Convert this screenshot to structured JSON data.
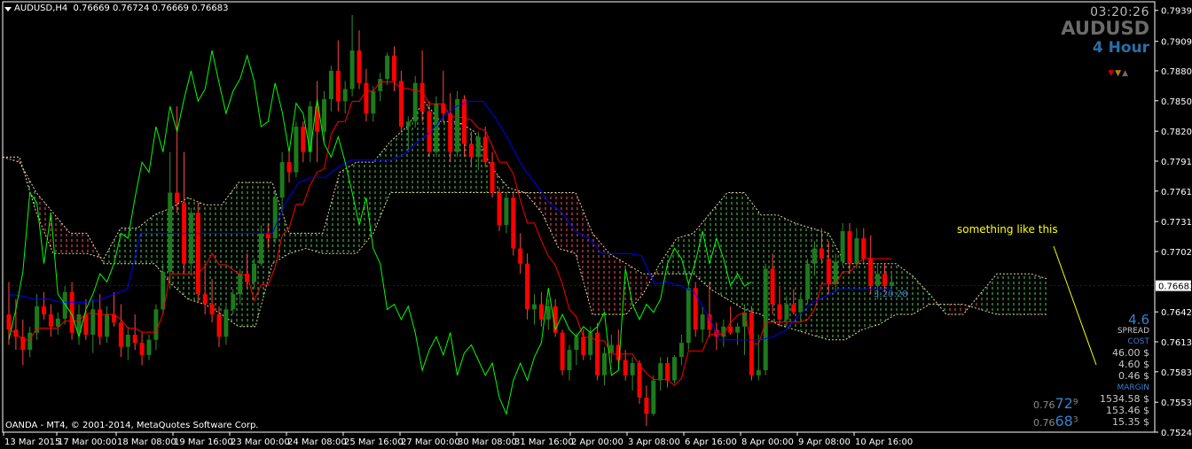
{
  "header": {
    "symbol_timeframe": "AUDUSD,H4",
    "ohlc": "0.76669 0.76724 0.76669 0.76683"
  },
  "overlay": {
    "clock": "03:20:26",
    "symbol": "AUDUSD",
    "timeframe": "4 Hour",
    "note": "something like this",
    "credit": "OANDA - MT4, © 2001-2014, MetaQuotes Software Corp.",
    "countdown": "3:20:28",
    "spread_value": "4.6",
    "spread_label": "SPREAD",
    "cost_label": "COST",
    "cost_values": [
      "46.00 $",
      "4.60 $",
      "0.46 $"
    ],
    "margin_label": "MARGIN",
    "margin_values": [
      "1534.58 $",
      "153.46 $",
      "15.35 $"
    ],
    "bid_prefix": "0.76",
    "bid_big": "72",
    "bid_sup": "9",
    "ask_prefix": "0.76",
    "ask_big": "68",
    "ask_sup": "3",
    "marker_colors": [
      "#cc0000",
      "#b8860b",
      "#6b6b6b"
    ]
  },
  "colors": {
    "background": "#000000",
    "bull": "#1c7a1c",
    "bear": "#ff0000",
    "tenkan": "#ff0000",
    "kijun": "#0000ff",
    "chikou": "#00ff00",
    "cloud_bear": "#ff5555",
    "cloud_bull": "#55cc55",
    "cloud_edge": "#e8d8a0",
    "grid_text": "#ffffff",
    "current_price_box": "#ffffff"
  },
  "chart_data": {
    "type": "candlestick",
    "symbol": "AUDUSD",
    "timeframe": "H4",
    "ylim": [
      0.7524,
      0.7948
    ],
    "y_ticks": [
      "0.79395",
      "0.79090",
      "0.78800",
      "0.78505",
      "0.78205",
      "0.77910",
      "0.77615",
      "0.77315",
      "0.77020",
      "0.76425",
      "0.76130",
      "0.75835",
      "0.75535",
      "0.75240"
    ],
    "current_price": "0.76683",
    "x_ticks": [
      "13 Mar 2015",
      "17 Mar 00:00",
      "18 Mar 08:00",
      "19 Mar 16:00",
      "23 Mar 00:00",
      "24 Mar 08:00",
      "25 Mar 16:00",
      "27 Mar 00:00",
      "30 Mar 08:00",
      "31 Mar 16:00",
      "2 Apr 00:00",
      "3 Apr 08:00",
      "6 Apr 16:00",
      "8 Apr 00:00",
      "9 Apr 08:00",
      "10 Apr 16:00"
    ],
    "candles": [
      [
        0.764,
        0.7672,
        0.761,
        0.7625
      ],
      [
        0.7625,
        0.7655,
        0.7605,
        0.7618
      ],
      [
        0.7618,
        0.7635,
        0.759,
        0.7605
      ],
      [
        0.7605,
        0.7628,
        0.7598,
        0.7622
      ],
      [
        0.7622,
        0.766,
        0.7615,
        0.7648
      ],
      [
        0.7648,
        0.7662,
        0.7635,
        0.764
      ],
      [
        0.764,
        0.765,
        0.7618,
        0.7628
      ],
      [
        0.7628,
        0.7642,
        0.762,
        0.7636
      ],
      [
        0.7636,
        0.7668,
        0.763,
        0.7662
      ],
      [
        0.7662,
        0.7672,
        0.7615,
        0.7622
      ],
      [
        0.7622,
        0.765,
        0.761,
        0.764
      ],
      [
        0.764,
        0.7655,
        0.7615,
        0.762
      ],
      [
        0.762,
        0.7655,
        0.7602,
        0.7645
      ],
      [
        0.7645,
        0.766,
        0.761,
        0.7618
      ],
      [
        0.7618,
        0.7648,
        0.7612,
        0.764
      ],
      [
        0.764,
        0.7662,
        0.7628,
        0.7632
      ],
      [
        0.7632,
        0.765,
        0.7598,
        0.7608
      ],
      [
        0.7608,
        0.7628,
        0.7595,
        0.762
      ],
      [
        0.762,
        0.764,
        0.7605,
        0.7612
      ],
      [
        0.7612,
        0.7622,
        0.759,
        0.76
      ],
      [
        0.76,
        0.762,
        0.7595,
        0.7615
      ],
      [
        0.7615,
        0.765,
        0.7605,
        0.7645
      ],
      [
        0.7645,
        0.769,
        0.764,
        0.7682
      ],
      [
        0.7682,
        0.78,
        0.7665,
        0.776
      ],
      [
        0.776,
        0.7845,
        0.774,
        0.775
      ],
      [
        0.775,
        0.78,
        0.768,
        0.769
      ],
      [
        0.769,
        0.7745,
        0.7678,
        0.774
      ],
      [
        0.774,
        0.775,
        0.7652,
        0.766
      ],
      [
        0.766,
        0.769,
        0.764,
        0.765
      ],
      [
        0.765,
        0.7675,
        0.7632,
        0.764
      ],
      [
        0.764,
        0.7648,
        0.7608,
        0.7618
      ],
      [
        0.7618,
        0.765,
        0.761,
        0.7645
      ],
      [
        0.7645,
        0.7665,
        0.764,
        0.766
      ],
      [
        0.766,
        0.7685,
        0.765,
        0.768
      ],
      [
        0.768,
        0.77,
        0.7665,
        0.7672
      ],
      [
        0.7672,
        0.7695,
        0.7665,
        0.769
      ],
      [
        0.769,
        0.7728,
        0.7688,
        0.772
      ],
      [
        0.772,
        0.773,
        0.7705,
        0.7715
      ],
      [
        0.7715,
        0.776,
        0.771,
        0.7755
      ],
      [
        0.7755,
        0.78,
        0.774,
        0.779
      ],
      [
        0.779,
        0.78,
        0.777,
        0.778
      ],
      [
        0.778,
        0.783,
        0.7775,
        0.7825
      ],
      [
        0.7825,
        0.783,
        0.779,
        0.78
      ],
      [
        0.78,
        0.785,
        0.779,
        0.7845
      ],
      [
        0.7845,
        0.787,
        0.779,
        0.782
      ],
      [
        0.782,
        0.786,
        0.781,
        0.7852
      ],
      [
        0.7852,
        0.7885,
        0.784,
        0.788
      ],
      [
        0.788,
        0.791,
        0.784,
        0.785
      ],
      [
        0.785,
        0.787,
        0.7838,
        0.7862
      ],
      [
        0.7862,
        0.7935,
        0.7855,
        0.79
      ],
      [
        0.79,
        0.792,
        0.7862,
        0.7868
      ],
      [
        0.7868,
        0.7882,
        0.783,
        0.7838
      ],
      [
        0.7838,
        0.7865,
        0.783,
        0.786
      ],
      [
        0.786,
        0.7878,
        0.785,
        0.7872
      ],
      [
        0.7872,
        0.7898,
        0.7866,
        0.7895
      ],
      [
        0.7895,
        0.7904,
        0.786,
        0.787
      ],
      [
        0.787,
        0.788,
        0.782,
        0.7825
      ],
      [
        0.7825,
        0.7835,
        0.78,
        0.783
      ],
      [
        0.783,
        0.7875,
        0.7824,
        0.7868
      ],
      [
        0.7868,
        0.79,
        0.783,
        0.784
      ],
      [
        0.784,
        0.785,
        0.7795,
        0.78
      ],
      [
        0.78,
        0.7855,
        0.7795,
        0.7848
      ],
      [
        0.7848,
        0.788,
        0.783,
        0.7838
      ],
      [
        0.7838,
        0.7858,
        0.779,
        0.78
      ],
      [
        0.78,
        0.786,
        0.7795,
        0.7852
      ],
      [
        0.7852,
        0.7856,
        0.7795,
        0.7808
      ],
      [
        0.7808,
        0.782,
        0.7785,
        0.7795
      ],
      [
        0.7795,
        0.782,
        0.7782,
        0.7815
      ],
      [
        0.7815,
        0.7825,
        0.7785,
        0.779
      ],
      [
        0.779,
        0.78,
        0.7755,
        0.776
      ],
      [
        0.776,
        0.7765,
        0.7722,
        0.7728
      ],
      [
        0.7728,
        0.776,
        0.772,
        0.7755
      ],
      [
        0.7755,
        0.776,
        0.7698,
        0.7705
      ],
      [
        0.7705,
        0.772,
        0.768,
        0.769
      ],
      [
        0.769,
        0.77,
        0.7635,
        0.7645
      ],
      [
        0.7645,
        0.766,
        0.763,
        0.765
      ],
      [
        0.765,
        0.7662,
        0.7628,
        0.7635
      ],
      [
        0.7635,
        0.7655,
        0.7625,
        0.7648
      ],
      [
        0.7648,
        0.7655,
        0.7618,
        0.7622
      ],
      [
        0.7622,
        0.7625,
        0.758,
        0.7585
      ],
      [
        0.7585,
        0.761,
        0.7575,
        0.7605
      ],
      [
        0.7605,
        0.7622,
        0.759,
        0.7618
      ],
      [
        0.7618,
        0.7625,
        0.7595,
        0.76
      ],
      [
        0.76,
        0.7628,
        0.7595,
        0.7622
      ],
      [
        0.7622,
        0.7632,
        0.7575,
        0.758
      ],
      [
        0.758,
        0.7608,
        0.757,
        0.7602
      ],
      [
        0.7602,
        0.762,
        0.7592,
        0.761
      ],
      [
        0.761,
        0.7625,
        0.759,
        0.7595
      ],
      [
        0.7595,
        0.7605,
        0.7575,
        0.758
      ],
      [
        0.758,
        0.7598,
        0.7565,
        0.7592
      ],
      [
        0.7592,
        0.7595,
        0.7552,
        0.7558
      ],
      [
        0.7558,
        0.757,
        0.753,
        0.7542
      ],
      [
        0.7542,
        0.758,
        0.754,
        0.7575
      ],
      [
        0.7575,
        0.7598,
        0.7565,
        0.7592
      ],
      [
        0.7592,
        0.7598,
        0.7568,
        0.7575
      ],
      [
        0.7575,
        0.76,
        0.7572,
        0.7598
      ],
      [
        0.7598,
        0.762,
        0.759,
        0.7612
      ],
      [
        0.7612,
        0.7672,
        0.7605,
        0.7666
      ],
      [
        0.7666,
        0.7672,
        0.7618,
        0.7625
      ],
      [
        0.7625,
        0.7648,
        0.7612,
        0.764
      ],
      [
        0.764,
        0.7672,
        0.7618,
        0.7625
      ],
      [
        0.7625,
        0.7632,
        0.7605,
        0.7618
      ],
      [
        0.7618,
        0.7635,
        0.7608,
        0.7628
      ],
      [
        0.7628,
        0.7648,
        0.762,
        0.7622
      ],
      [
        0.7622,
        0.7632,
        0.761,
        0.7628
      ],
      [
        0.7628,
        0.765,
        0.76,
        0.7642
      ],
      [
        0.7642,
        0.7648,
        0.7575,
        0.758
      ],
      [
        0.758,
        0.762,
        0.7575,
        0.7585
      ],
      [
        0.7585,
        0.769,
        0.758,
        0.7685
      ],
      [
        0.7685,
        0.77,
        0.764,
        0.765
      ],
      [
        0.765,
        0.7668,
        0.7628,
        0.7635
      ],
      [
        0.7635,
        0.7658,
        0.7628,
        0.765
      ],
      [
        0.765,
        0.7665,
        0.764,
        0.7642
      ],
      [
        0.7642,
        0.766,
        0.7635,
        0.7655
      ],
      [
        0.7655,
        0.7695,
        0.765,
        0.769
      ],
      [
        0.769,
        0.7712,
        0.7678,
        0.7705
      ],
      [
        0.7705,
        0.7725,
        0.769,
        0.7695
      ],
      [
        0.7695,
        0.7712,
        0.766,
        0.767
      ],
      [
        0.767,
        0.77,
        0.7662,
        0.7692
      ],
      [
        0.7692,
        0.773,
        0.7688,
        0.7722
      ],
      [
        0.7722,
        0.773,
        0.768,
        0.769
      ],
      [
        0.769,
        0.7725,
        0.7685,
        0.7715
      ],
      [
        0.7715,
        0.7725,
        0.769,
        0.7695
      ],
      [
        0.7695,
        0.7718,
        0.766,
        0.7668
      ],
      [
        0.7668,
        0.769,
        0.7655,
        0.768
      ],
      [
        0.768,
        0.769,
        0.7662,
        0.7668
      ],
      [
        0.7668,
        0.768,
        0.7664,
        0.7672
      ]
    ],
    "kijun": [
      0.766,
      0.7658,
      0.7655,
      0.7655,
      0.7652,
      0.7652,
      0.7652,
      0.7655,
      0.766,
      0.7665,
      0.772,
      0.772,
      0.772,
      0.772,
      0.772,
      0.772,
      0.772,
      0.772,
      0.772,
      0.772,
      0.772,
      0.775,
      0.777,
      0.7775,
      0.7775,
      0.7785,
      0.7792,
      0.7792,
      0.7792,
      0.7792,
      0.7798,
      0.781,
      0.782,
      0.7835,
      0.7845,
      0.785,
      0.785,
      0.7832,
      0.781,
      0.7785,
      0.7768,
      0.775,
      0.774,
      0.7722,
      0.7715,
      0.77,
      0.77,
      0.77,
      0.7698,
      0.767,
      0.7672,
      0.7668,
      0.7662,
      0.764,
      0.7615,
      0.7615,
      0.7615,
      0.7615,
      0.7618,
      0.7625,
      0.764,
      0.7652,
      0.7658,
      0.7665,
      0.7665,
      0.7665,
      0.7665,
      0.7665
    ],
    "notes": "Ichimoku indicator (tenkan red, kijun blue, chikou green, cloud hatched) drawn approximately."
  }
}
